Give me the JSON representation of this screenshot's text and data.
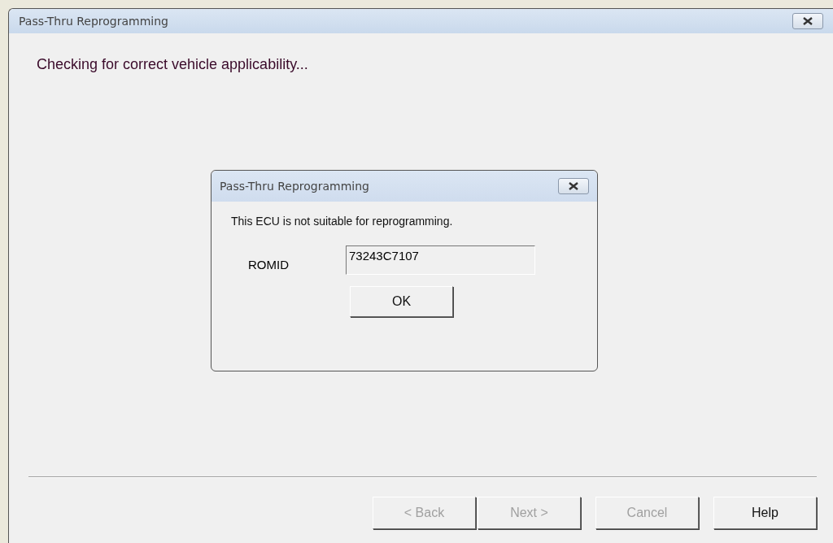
{
  "window": {
    "title": "Pass-Thru Reprogramming"
  },
  "message": "Checking for correct vehicle applicability...",
  "dialog": {
    "title": "Pass-Thru Reprogramming",
    "message": "This ECU is not suitable for reprogramming.",
    "field_label": "ROMID",
    "field_value": "73243C7107",
    "button": "OK"
  },
  "buttons": [
    {
      "label": "< Back",
      "disabled": true
    },
    {
      "label": "Next >",
      "disabled": true
    },
    {
      "label": "Cancel",
      "disabled": true
    },
    {
      "label": "Help",
      "disabled": false
    }
  ]
}
